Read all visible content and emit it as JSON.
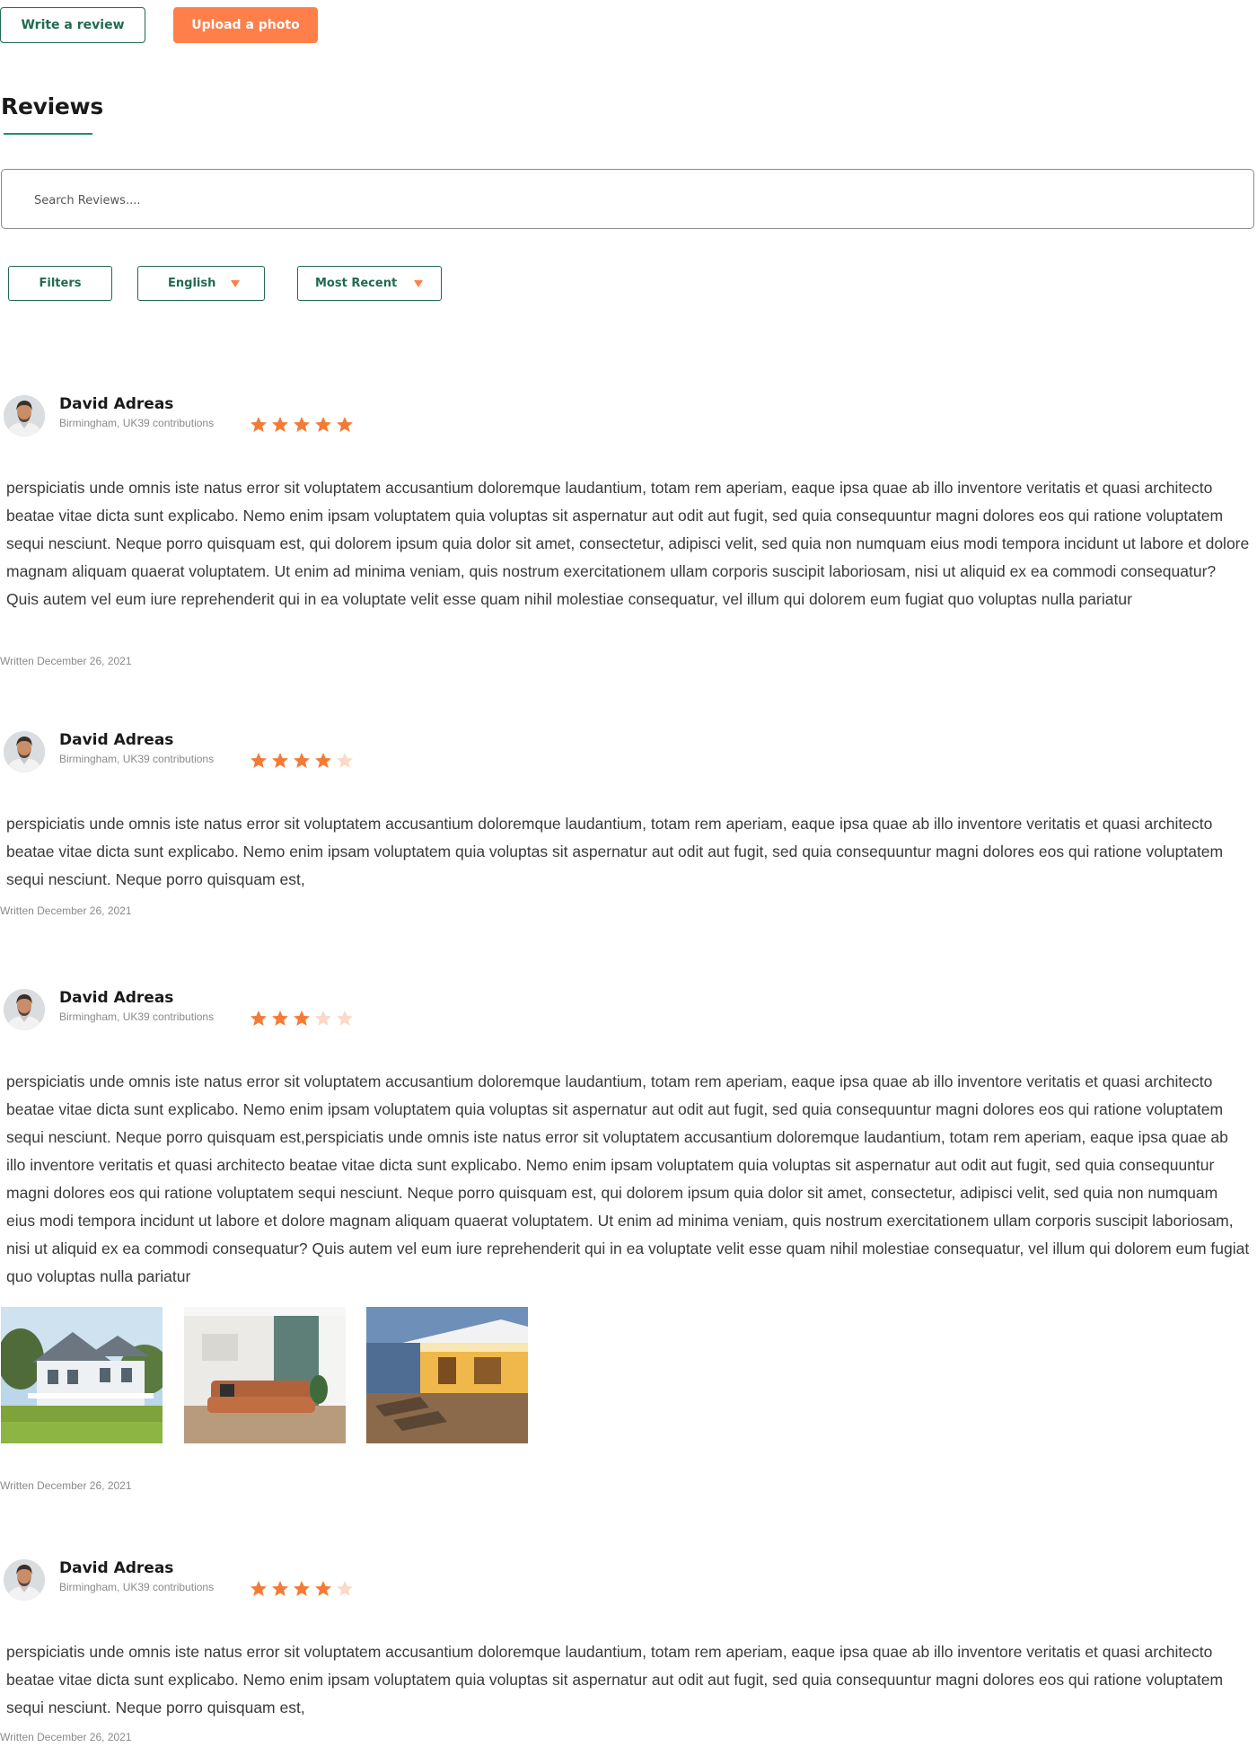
{
  "actions": {
    "write_review": "Write a review",
    "upload_photo": "Upload a photo"
  },
  "heading": "Reviews",
  "search": {
    "placeholder": "Search Reviews....",
    "value": ""
  },
  "filters": {
    "filters_label": "Filters",
    "language": "English",
    "sort": "Most Recent"
  },
  "colors": {
    "accent_orange": "#ff7f4a",
    "brand_green": "#1f6b50",
    "star_filled": "#f47b35",
    "star_empty": "#fbd9c6"
  },
  "reviews": [
    {
      "name": "David Adreas",
      "meta": "Birmingham, UK39 contributions",
      "rating": 5,
      "text": "perspiciatis unde omnis iste natus error sit voluptatem accusantium doloremque laudantium, totam rem aperiam, eaque ipsa quae ab illo inventore veritatis et quasi architecto beatae vitae dicta sunt explicabo. Nemo enim ipsam voluptatem quia voluptas sit aspernatur aut odit aut fugit, sed quia consequuntur magni dolores eos qui ratione voluptatem sequi nesciunt. Neque porro quisquam est, qui dolorem ipsum quia dolor sit amet, consectetur, adipisci velit, sed quia non numquam eius modi tempora incidunt ut labore et dolore magnam aliquam quaerat voluptatem. Ut enim ad minima veniam, quis nostrum exercitationem ullam corporis suscipit laboriosam, nisi ut aliquid ex ea commodi consequatur? Quis autem vel eum iure reprehenderit qui in ea voluptate velit esse quam nihil molestiae consequatur, vel illum qui dolorem eum fugiat quo voluptas nulla pariatur",
      "date": "Written December 26, 2021"
    },
    {
      "name": "David Adreas",
      "meta": "Birmingham, UK39 contributions",
      "rating": 4,
      "text": "perspiciatis unde omnis iste natus error sit voluptatem accusantium doloremque laudantium, totam rem aperiam, eaque ipsa quae ab illo inventore veritatis et quasi architecto beatae vitae dicta sunt explicabo. Nemo enim ipsam voluptatem quia voluptas sit aspernatur aut odit aut fugit, sed quia consequuntur magni dolores eos qui ratione voluptatem sequi nesciunt. Neque porro quisquam est,",
      "date": "Written December 26, 2021"
    },
    {
      "name": "David Adreas",
      "meta": "Birmingham, UK39 contributions",
      "rating": 3,
      "text": "perspiciatis unde omnis iste natus error sit voluptatem accusantium doloremque laudantium, totam rem aperiam, eaque ipsa quae ab illo inventore veritatis et quasi architecto beatae vitae dicta sunt explicabo. Nemo enim ipsam voluptatem quia voluptas sit aspernatur aut odit aut fugit, sed quia consequuntur magni dolores eos qui ratione voluptatem sequi nesciunt. Neque porro quisquam est,perspiciatis unde omnis iste natus error sit voluptatem accusantium doloremque laudantium, totam rem aperiam, eaque ipsa quae ab illo inventore veritatis et quasi architecto beatae vitae dicta sunt explicabo. Nemo enim ipsam voluptatem quia voluptas sit aspernatur aut odit aut fugit, sed quia consequuntur magni dolores eos qui ratione voluptatem sequi nesciunt. Neque porro quisquam est, qui dolorem ipsum quia dolor sit amet, consectetur, adipisci velit, sed quia non numquam eius modi tempora incidunt ut labore et dolore magnam aliquam quaerat voluptatem. Ut enim ad minima veniam, quis nostrum exercitationem ullam corporis suscipit laboriosam, nisi ut aliquid ex ea commodi consequatur? Quis autem vel eum iure reprehenderit qui in ea voluptate velit esse quam nihil molestiae consequatur, vel illum qui dolorem eum fugiat quo voluptas nulla pariatur",
      "photos": [
        "house-exterior-photo",
        "living-room-photo",
        "patio-deck-photo"
      ],
      "date": "Written December 26, 2021"
    },
    {
      "name": "David Adreas",
      "meta": "Birmingham, UK39 contributions",
      "rating": 4,
      "text": "perspiciatis unde omnis iste natus error sit voluptatem accusantium doloremque laudantium, totam rem aperiam, eaque ipsa quae ab illo inventore veritatis et quasi architecto beatae vitae dicta sunt explicabo. Nemo enim ipsam voluptatem quia voluptas sit aspernatur aut odit aut fugit, sed quia consequuntur magni dolores eos qui ratione voluptatem sequi nesciunt. Neque porro quisquam est,",
      "date": "Written December 26, 2021"
    }
  ]
}
